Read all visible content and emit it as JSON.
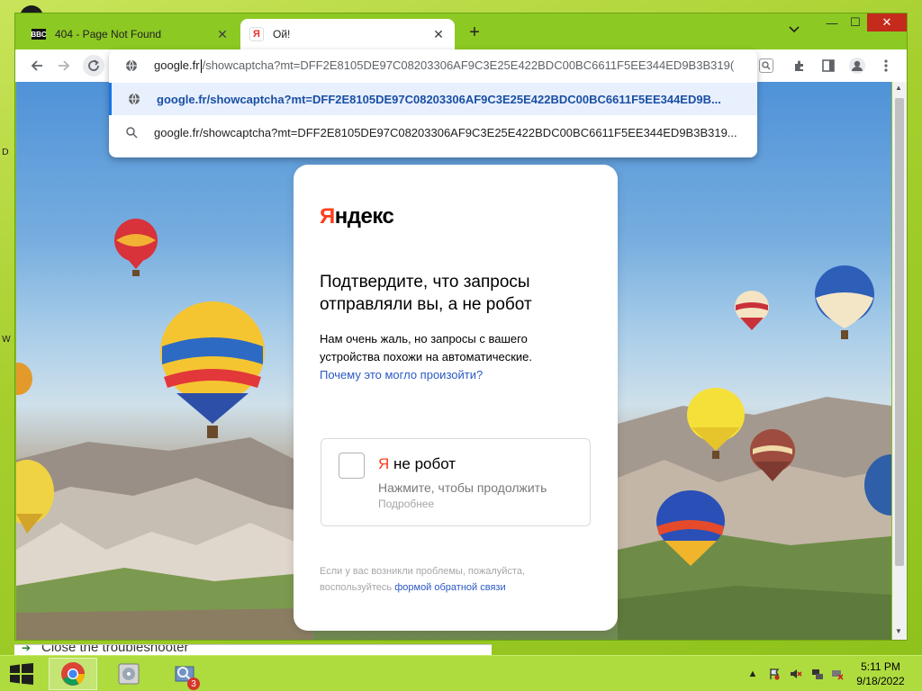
{
  "desktop": {
    "side_letters": [
      "D",
      "W"
    ]
  },
  "tabs": [
    {
      "favicon": "BBC",
      "title": "404 - Page Not Found",
      "close": "✕"
    },
    {
      "favicon": "Я",
      "title": "Ой!",
      "close": "✕"
    }
  ],
  "tabbar": {
    "new_tab": "+",
    "search_tabs": "⌄"
  },
  "window_controls": {
    "minimize": "—",
    "maximize": "☐",
    "close": "✕"
  },
  "omnibox": {
    "typed_prefix": "google.fr",
    "typed_suffix": "/showcaptcha?mt=DFF2E8105DE97C08203306AF9C3E25E422BDC00BC6611F5EE344ED9B3B319(",
    "suggestions": [
      {
        "icon": "globe-icon",
        "text": "google.fr/showcaptcha?mt=DFF2E8105DE97C08203306AF9C3E25E422BDC00BC6611F5EE344ED9B..."
      },
      {
        "icon": "search-icon",
        "text": "google.fr/showcaptcha?mt=DFF2E8105DE97C08203306AF9C3E25E422BDC00BC6611F5EE344ED9B3B319..."
      }
    ]
  },
  "captcha": {
    "logo_first": "Я",
    "logo_rest": "ндекс",
    "heading": "Подтвердите, что запросы отправляли вы, а не робот",
    "description": "Нам очень жаль, но запросы с вашего устройства похожи на автоматические.",
    "description_link": "Почему это могло произойти?",
    "checkbox_ya": "Я",
    "checkbox_label": " не робот",
    "checkbox_sub": "Нажмите, чтобы продолжить",
    "checkbox_more": "Подробнее",
    "footer_text": "Если у вас возникли проблемы, пожалуйста, воспользуйтесь",
    "footer_link": "формой обратной связи"
  },
  "behind_window": {
    "text": "Close the troubleshooter"
  },
  "taskbar": {
    "chrome_label": "Google Chrome",
    "badge": "3",
    "clock_time": "5:11 PM",
    "clock_date": "9/18/2022"
  },
  "colors": {
    "accent": "#1a73e8",
    "yandex_red": "#fc3f1d",
    "link": "#2a59c5",
    "desktop": "#a6cf2e"
  }
}
